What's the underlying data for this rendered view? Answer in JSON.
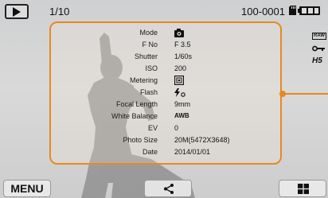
{
  "status_bar": {
    "image_counter": "1/10",
    "file_number": "100-0001"
  },
  "info_panel": {
    "rows": [
      {
        "label": "Mode",
        "value": ""
      },
      {
        "label": "F No",
        "value": "F 3.5"
      },
      {
        "label": "Shutter",
        "value": "1/60s"
      },
      {
        "label": "ISO",
        "value": "200"
      },
      {
        "label": "Metering",
        "value": ""
      },
      {
        "label": "Flash",
        "value": ""
      },
      {
        "label": "Focal Length",
        "value": "9mm"
      },
      {
        "label": "White Balance",
        "value": "AWB"
      },
      {
        "label": "EV",
        "value": "0"
      },
      {
        "label": "Photo Size",
        "value": "20M(5472X3648)"
      },
      {
        "label": "Date",
        "value": "2014/01/01"
      }
    ]
  },
  "side_icons": {
    "raw_label": "RAW",
    "hs_label": "H5"
  },
  "buttons": {
    "menu_label": "MENU"
  },
  "colors": {
    "accent": "#e58a20"
  }
}
